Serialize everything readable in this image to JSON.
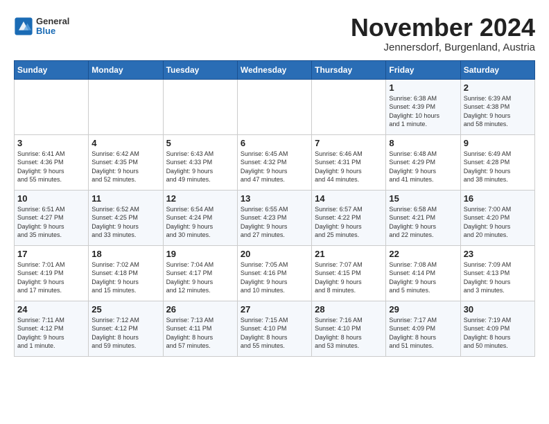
{
  "logo": {
    "general": "General",
    "blue": "Blue"
  },
  "title": "November 2024",
  "subtitle": "Jennersdorf, Burgenland, Austria",
  "headers": [
    "Sunday",
    "Monday",
    "Tuesday",
    "Wednesday",
    "Thursday",
    "Friday",
    "Saturday"
  ],
  "weeks": [
    [
      {
        "day": "",
        "info": ""
      },
      {
        "day": "",
        "info": ""
      },
      {
        "day": "",
        "info": ""
      },
      {
        "day": "",
        "info": ""
      },
      {
        "day": "",
        "info": ""
      },
      {
        "day": "1",
        "info": "Sunrise: 6:38 AM\nSunset: 4:39 PM\nDaylight: 10 hours\nand 1 minute."
      },
      {
        "day": "2",
        "info": "Sunrise: 6:39 AM\nSunset: 4:38 PM\nDaylight: 9 hours\nand 58 minutes."
      }
    ],
    [
      {
        "day": "3",
        "info": "Sunrise: 6:41 AM\nSunset: 4:36 PM\nDaylight: 9 hours\nand 55 minutes."
      },
      {
        "day": "4",
        "info": "Sunrise: 6:42 AM\nSunset: 4:35 PM\nDaylight: 9 hours\nand 52 minutes."
      },
      {
        "day": "5",
        "info": "Sunrise: 6:43 AM\nSunset: 4:33 PM\nDaylight: 9 hours\nand 49 minutes."
      },
      {
        "day": "6",
        "info": "Sunrise: 6:45 AM\nSunset: 4:32 PM\nDaylight: 9 hours\nand 47 minutes."
      },
      {
        "day": "7",
        "info": "Sunrise: 6:46 AM\nSunset: 4:31 PM\nDaylight: 9 hours\nand 44 minutes."
      },
      {
        "day": "8",
        "info": "Sunrise: 6:48 AM\nSunset: 4:29 PM\nDaylight: 9 hours\nand 41 minutes."
      },
      {
        "day": "9",
        "info": "Sunrise: 6:49 AM\nSunset: 4:28 PM\nDaylight: 9 hours\nand 38 minutes."
      }
    ],
    [
      {
        "day": "10",
        "info": "Sunrise: 6:51 AM\nSunset: 4:27 PM\nDaylight: 9 hours\nand 35 minutes."
      },
      {
        "day": "11",
        "info": "Sunrise: 6:52 AM\nSunset: 4:25 PM\nDaylight: 9 hours\nand 33 minutes."
      },
      {
        "day": "12",
        "info": "Sunrise: 6:54 AM\nSunset: 4:24 PM\nDaylight: 9 hours\nand 30 minutes."
      },
      {
        "day": "13",
        "info": "Sunrise: 6:55 AM\nSunset: 4:23 PM\nDaylight: 9 hours\nand 27 minutes."
      },
      {
        "day": "14",
        "info": "Sunrise: 6:57 AM\nSunset: 4:22 PM\nDaylight: 9 hours\nand 25 minutes."
      },
      {
        "day": "15",
        "info": "Sunrise: 6:58 AM\nSunset: 4:21 PM\nDaylight: 9 hours\nand 22 minutes."
      },
      {
        "day": "16",
        "info": "Sunrise: 7:00 AM\nSunset: 4:20 PM\nDaylight: 9 hours\nand 20 minutes."
      }
    ],
    [
      {
        "day": "17",
        "info": "Sunrise: 7:01 AM\nSunset: 4:19 PM\nDaylight: 9 hours\nand 17 minutes."
      },
      {
        "day": "18",
        "info": "Sunrise: 7:02 AM\nSunset: 4:18 PM\nDaylight: 9 hours\nand 15 minutes."
      },
      {
        "day": "19",
        "info": "Sunrise: 7:04 AM\nSunset: 4:17 PM\nDaylight: 9 hours\nand 12 minutes."
      },
      {
        "day": "20",
        "info": "Sunrise: 7:05 AM\nSunset: 4:16 PM\nDaylight: 9 hours\nand 10 minutes."
      },
      {
        "day": "21",
        "info": "Sunrise: 7:07 AM\nSunset: 4:15 PM\nDaylight: 9 hours\nand 8 minutes."
      },
      {
        "day": "22",
        "info": "Sunrise: 7:08 AM\nSunset: 4:14 PM\nDaylight: 9 hours\nand 5 minutes."
      },
      {
        "day": "23",
        "info": "Sunrise: 7:09 AM\nSunset: 4:13 PM\nDaylight: 9 hours\nand 3 minutes."
      }
    ],
    [
      {
        "day": "24",
        "info": "Sunrise: 7:11 AM\nSunset: 4:12 PM\nDaylight: 9 hours\nand 1 minute."
      },
      {
        "day": "25",
        "info": "Sunrise: 7:12 AM\nSunset: 4:12 PM\nDaylight: 8 hours\nand 59 minutes."
      },
      {
        "day": "26",
        "info": "Sunrise: 7:13 AM\nSunset: 4:11 PM\nDaylight: 8 hours\nand 57 minutes."
      },
      {
        "day": "27",
        "info": "Sunrise: 7:15 AM\nSunset: 4:10 PM\nDaylight: 8 hours\nand 55 minutes."
      },
      {
        "day": "28",
        "info": "Sunrise: 7:16 AM\nSunset: 4:10 PM\nDaylight: 8 hours\nand 53 minutes."
      },
      {
        "day": "29",
        "info": "Sunrise: 7:17 AM\nSunset: 4:09 PM\nDaylight: 8 hours\nand 51 minutes."
      },
      {
        "day": "30",
        "info": "Sunrise: 7:19 AM\nSunset: 4:09 PM\nDaylight: 8 hours\nand 50 minutes."
      }
    ]
  ]
}
